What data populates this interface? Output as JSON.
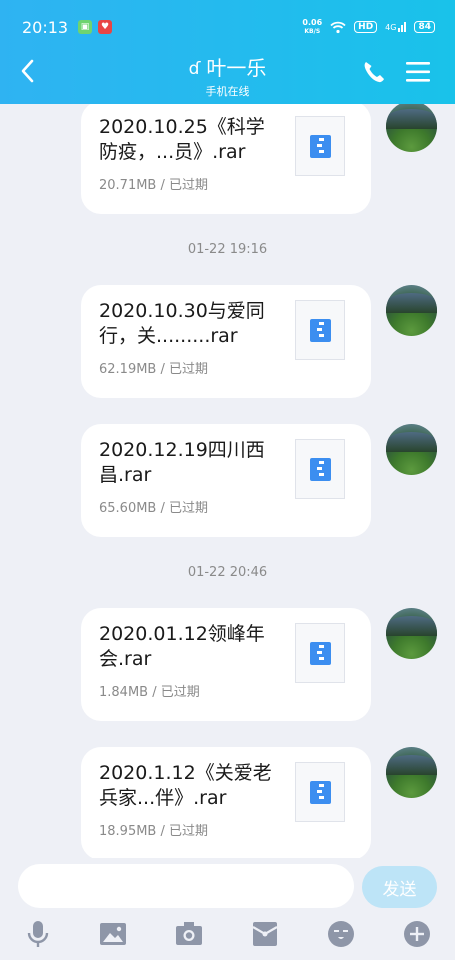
{
  "status_bar": {
    "time": "20:13",
    "net_speed_value": "0.06",
    "net_speed_unit": "KB/S",
    "hd_label": "HD",
    "signal_label": "4G",
    "battery": "84"
  },
  "header": {
    "contact_name": "叶一乐",
    "contact_status": "手机在线"
  },
  "messages": [
    {
      "filename": "2020.10.25《科学防疫，...员》.rar",
      "meta": "20.71MB / 已过期"
    },
    {
      "filename": "2020.10.30与爱同行，关.........rar",
      "meta": "62.19MB / 已过期"
    },
    {
      "filename": "2020.12.19四川西昌.rar",
      "meta": "65.60MB / 已过期"
    },
    {
      "filename": "2020.01.12领峰年会.rar",
      "meta": "1.84MB / 已过期"
    },
    {
      "filename": "2020.1.12《关爱老兵家...伴》.rar",
      "meta": "18.95MB / 已过期"
    }
  ],
  "timestamps": [
    "01-22 19:16",
    "01-22 20:46"
  ],
  "input_bar": {
    "value": "",
    "send_label": "发送"
  },
  "toolbar_icons": [
    "microphone-icon",
    "image-icon",
    "camera-icon",
    "red-packet-icon",
    "emoji-icon",
    "plus-icon"
  ],
  "colors": {
    "header_start": "#2fb3f2",
    "header_end": "#19c2ea",
    "background": "#eef0f6",
    "send_button": "#bde4f7",
    "file_icon": "#3c8ef0"
  }
}
